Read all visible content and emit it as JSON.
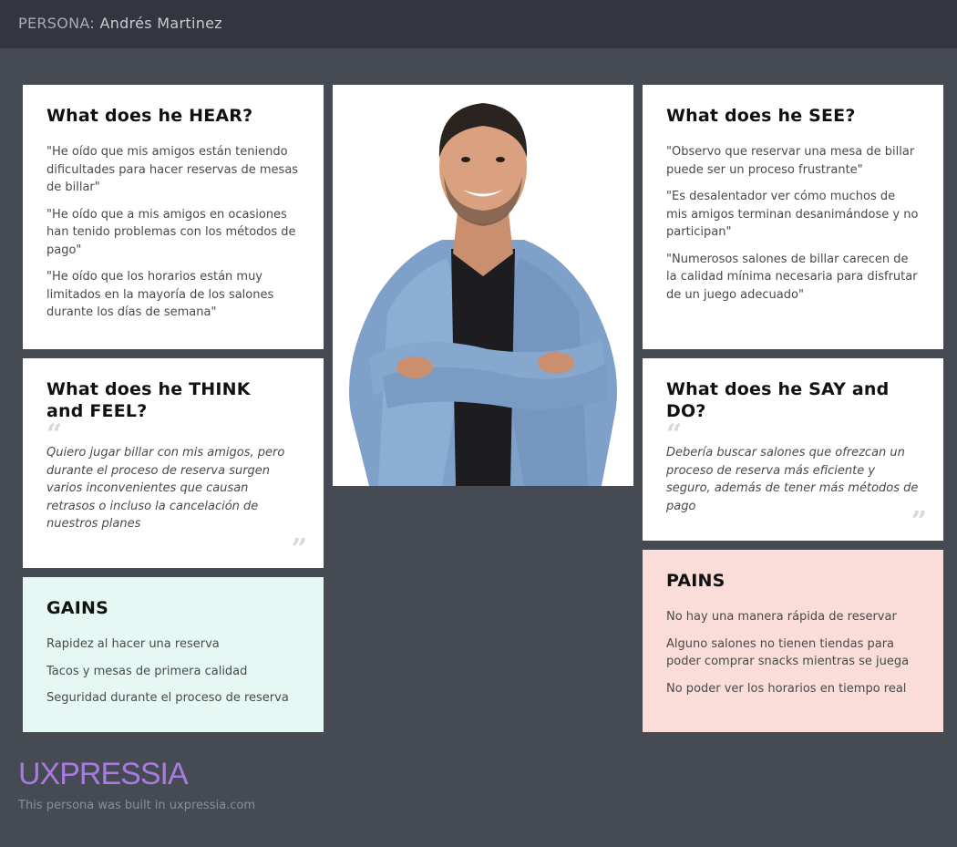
{
  "header": {
    "prefix": "PERSONA:",
    "name": "Andrés Martinez"
  },
  "hear": {
    "title": "What does he HEAR?",
    "items": [
      "\"He oído que mis amigos están teniendo dificultades para hacer reservas de mesas de billar\"",
      "\"He oído que a mis amigos en ocasiones han tenido problemas con los métodos de pago\"",
      "\"He oído que los horarios están muy limitados en la mayoría de los salones durante los días de semana\""
    ]
  },
  "see": {
    "title": "What does he SEE?",
    "items": [
      "\"Observo que reservar una mesa de billar puede ser un proceso frustrante\"",
      "\"Es desalentador ver cómo muchos de mis amigos terminan desanimándose y no participan\"",
      "\"Numerosos salones de billar carecen de la calidad mínima necesaria para disfrutar de un juego adecuado\""
    ]
  },
  "think": {
    "title": "What does he THINK and FEEL?",
    "quote": "Quiero jugar billar con mis amigos, pero durante el proceso de reserva surgen varios inconvenientes que causan retrasos o incluso la cancelación de nuestros planes"
  },
  "say": {
    "title": "What does he SAY and DO?",
    "quote": "Debería buscar salones que ofrezcan un proceso de reserva más eficiente y seguro, además de tener más métodos de pago"
  },
  "gains": {
    "title": "GAINS",
    "items": [
      "Rapidez al hacer una reserva",
      "Tacos y mesas de primera calidad",
      "Seguridad durante el proceso de reserva"
    ]
  },
  "pains": {
    "title": "PAINS",
    "items": [
      "No hay una manera rápida de reservar",
      "Alguno salones no tienen tiendas para poder comprar snacks mientras se juega",
      "No poder ver los horarios en tiempo real"
    ]
  },
  "footer": {
    "brand": "UXPRESSIA",
    "note": "This persona was built in uxpressia.com"
  },
  "colors": {
    "background": "#454a53",
    "topbar": "#33363e",
    "gains": "#e6f8f4",
    "pains": "#fadcd9",
    "brand": "#a77be0"
  }
}
